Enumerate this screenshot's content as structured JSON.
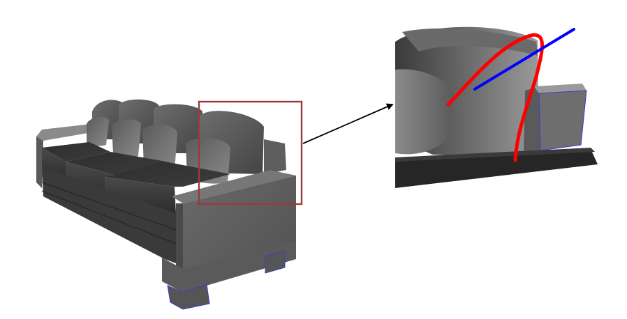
{
  "figure": {
    "overview": {
      "subject": "sofa-3d-render",
      "highlight_color": "#9b3a3a"
    },
    "zoom": {
      "subject": "armrest-and-cushion-closeup",
      "curves": [
        {
          "role": "curve",
          "color": "#ff0000"
        },
        {
          "role": "line",
          "color": "#0000ff"
        }
      ]
    },
    "connector": {
      "style": "arrow",
      "color": "#000000"
    }
  }
}
